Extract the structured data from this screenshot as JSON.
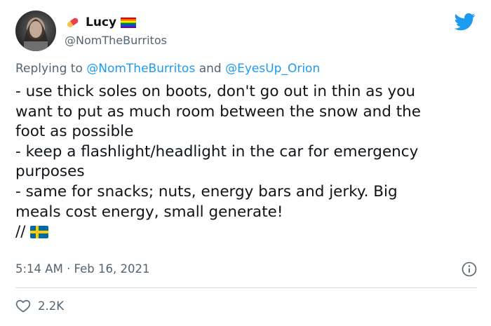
{
  "tweet": {
    "author": {
      "name": "Lucy",
      "handle": "@NomTheBurritos"
    },
    "reply": {
      "prefix": "Replying to ",
      "user1": "@NomTheBurritos",
      "joiner": " and ",
      "user2": "@EyesUp_Orion"
    },
    "body_lines": [
      "- use thick soles on boots, don't go out in thin as you",
      "want to put as much room between the snow and the",
      "foot as possible",
      "- keep a flashlight/headlight in the car for emergency",
      "purposes",
      "- same for snacks; nuts, energy bars and jerky. Big",
      "meals cost energy, small generate!",
      "//"
    ],
    "timestamp": "5:14 AM · Feb 16, 2021",
    "likes": "2.2K"
  },
  "colors": {
    "accent": "#1d9bf0",
    "text": "#0f1419",
    "muted": "#536471",
    "border": "#cfd9de",
    "like_icon": "#5b7083"
  },
  "icons": [
    "avatar",
    "pill-icon",
    "rainbow-flag-icon",
    "twitter-bird-icon",
    "sweden-flag-icon",
    "info-icon",
    "heart-icon"
  ]
}
